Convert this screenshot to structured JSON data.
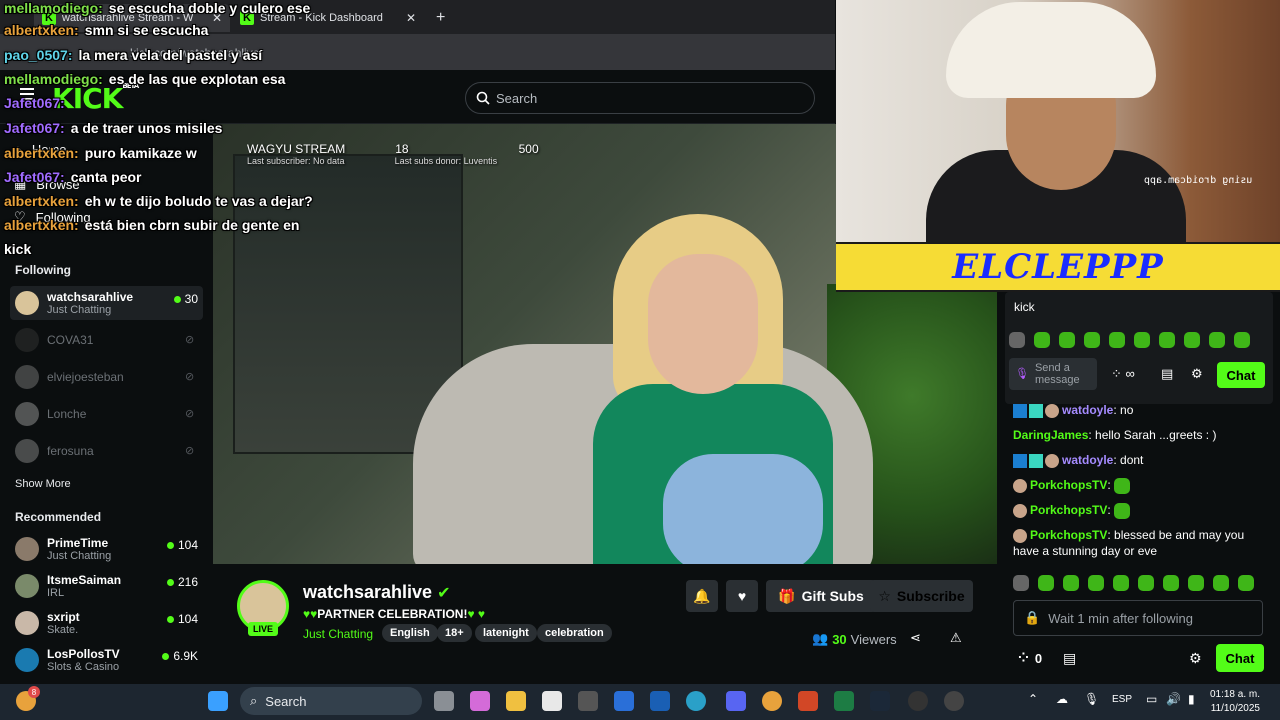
{
  "browser": {
    "tabs": [
      {
        "title": "watchsarahlive Stream - W"
      },
      {
        "title": "Stream - Kick Dashboard"
      }
    ],
    "new_tab": "+",
    "address": "kick.com/watchsarahlive"
  },
  "header": {
    "logo": "KICK",
    "logo_sup": "BETA",
    "search_placeholder": "Search"
  },
  "sidebar": {
    "nav": [
      {
        "label": "Home",
        "icon": "home-icon"
      },
      {
        "label": "Browse",
        "icon": "browse-icon"
      },
      {
        "label": "Following",
        "icon": "heart-icon"
      }
    ],
    "following_title": "Following",
    "following": [
      {
        "name": "watchsarahlive",
        "category": "Just Chatting",
        "viewers": "30",
        "live": true
      },
      {
        "name": "COVA31",
        "live": false
      },
      {
        "name": "elviejoesteban",
        "live": false
      },
      {
        "name": "Lonche",
        "live": false
      },
      {
        "name": "ferosuna",
        "live": false
      }
    ],
    "show_more": "Show More",
    "recommended_title": "Recommended",
    "recommended": [
      {
        "name": "PrimeTime",
        "category": "Just Chatting",
        "viewers": "104"
      },
      {
        "name": "ItsmeSaiman",
        "category": "IRL",
        "viewers": "216"
      },
      {
        "name": "sxript",
        "category": "Skate.",
        "viewers": "104"
      },
      {
        "name": "LosPollosTV",
        "category": "Slots & Casino",
        "viewers": "6.9K"
      }
    ]
  },
  "stream_overlay": {
    "title": "WAGYU STREAM",
    "count1": "18",
    "count2": "500",
    "last_subscriber": "Last subscriber: No data",
    "last_subs_donor": "Last subs donor: Luventis"
  },
  "chat_overlay": [
    {
      "name": "mellamodiego:",
      "text": "se escucha doble y culero ese",
      "color": "#7fe04a"
    },
    {
      "name": "albertxken:",
      "text": "smn si se escucha",
      "color": "#e8a23c"
    },
    {
      "name": "pao_0507:",
      "text": "la mera vela del pastel y así",
      "color": "#5fd3e8"
    },
    {
      "name": "mellamodiego:",
      "text": "es de las que explotan esa",
      "color": "#7fe04a"
    },
    {
      "name": "Jafet067:",
      "text": "",
      "color": "#a06bff"
    },
    {
      "name": "Jafet067:",
      "text": "a de traer unos misiles",
      "color": "#a06bff"
    },
    {
      "name": "albertxken:",
      "text": "puro kamikaze w",
      "color": "#e8a23c"
    },
    {
      "name": "Jafet067:",
      "text": "canta peor",
      "color": "#a06bff"
    },
    {
      "name": "albertxken:",
      "text": "eh w te dijo boludo te vas a dejar?",
      "color": "#e8a23c"
    },
    {
      "name": "albertxken:",
      "text": "está bien cbrn subir de gente en",
      "color": "#e8a23c"
    },
    {
      "name": "",
      "text": "kick",
      "color": "#ffffff"
    }
  ],
  "webcam": {
    "mirror_text": "using droidcam.app",
    "banner": "ELCLEPPP"
  },
  "popup": {
    "prev_text": "kick",
    "placeholder": "Send a message",
    "chat_button": "Chat"
  },
  "chat": {
    "messages": [
      {
        "name": "watdoyle",
        "text": "no",
        "color": "#a58bff"
      },
      {
        "name": "DaringJames",
        "text": "hello Sarah ...greets : )",
        "color": "#53fc18"
      },
      {
        "name": "watdoyle",
        "text": "dont",
        "color": "#a58bff"
      },
      {
        "name": "PorkchopsTV",
        "text": "",
        "color": "#53fc18"
      },
      {
        "name": "PorkchopsTV",
        "text": "",
        "color": "#53fc18"
      },
      {
        "name": "PorkchopsTV",
        "text": "blessed be and may you have a stunning day or eve",
        "color": "#53fc18"
      }
    ],
    "input_placeholder": "Wait 1 min after following",
    "points": "0",
    "chat_button": "Chat"
  },
  "channel": {
    "name": "watchsarahlive",
    "live": "LIVE",
    "title": "PARTNER CELEBRATION!",
    "category": "Just Chatting",
    "tags": [
      "English",
      "18+",
      "latenight",
      "celebration"
    ],
    "gift_subs": "Gift Subs",
    "subscribe": "Subscribe",
    "viewers_count": "30",
    "viewers_label": "Viewers"
  },
  "taskbar": {
    "search": "Search",
    "lang": "ESP",
    "time": "01:18 a. m.",
    "date": "11/10/2025",
    "notif_count": "8"
  },
  "colors": {
    "accent": "#53fc18",
    "bg": "#0b0e0f"
  }
}
